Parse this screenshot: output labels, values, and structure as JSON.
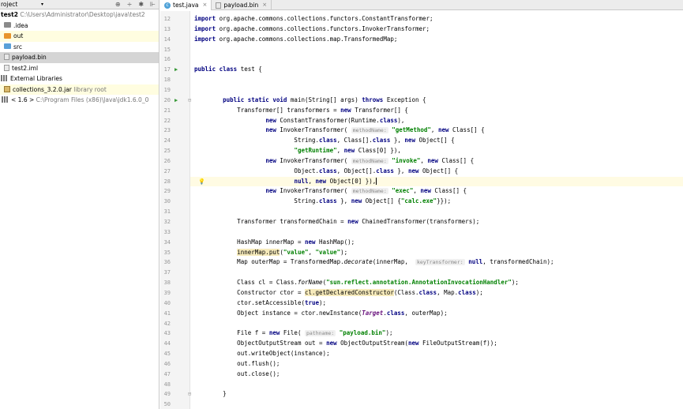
{
  "project_panel": {
    "header_label": "roject",
    "tools": [
      "⊕",
      "÷",
      "✱",
      "⊩"
    ],
    "tree": [
      {
        "name": "test2",
        "path": "C:\\Users\\Administrator\\Desktop\\java\\test2",
        "icon": "module-folder-icon",
        "indent": 0
      },
      {
        "name": ".idea",
        "path": "",
        "icon": "folder-icon",
        "indent": 1
      },
      {
        "name": "out",
        "path": "",
        "icon": "excluded-folder-icon",
        "indent": 1
      },
      {
        "name": "src",
        "path": "",
        "icon": "source-folder-icon",
        "indent": 1
      },
      {
        "name": "payload.bin",
        "path": "",
        "icon": "file-icon",
        "indent": 1
      },
      {
        "name": "test2.iml",
        "path": "",
        "icon": "file-icon",
        "indent": 1
      },
      {
        "name": "External Libraries",
        "path": "",
        "icon": "library-icon",
        "indent": 0
      },
      {
        "name": "collections_3.2.0.jar",
        "path": "library root",
        "icon": "jar-icon",
        "indent": 1
      },
      {
        "name": "< 1.6 >",
        "path": "C:\\Program Files (x86)\\Java\\jdk1.6.0_0",
        "icon": "jdk-icon",
        "indent": 1
      }
    ]
  },
  "tabs": [
    {
      "label": "test.java",
      "close": "×",
      "icon": "java-class-icon",
      "active": true
    },
    {
      "label": "payload.bin",
      "close": "×",
      "icon": "file-icon",
      "active": false
    }
  ],
  "editor": {
    "line_numbers": [
      "12",
      "13",
      "14",
      "15",
      "16",
      "17",
      "18",
      "19",
      "20",
      "21",
      "22",
      "23",
      "24",
      "25",
      "26",
      "27",
      "28",
      "29",
      "30",
      "31",
      "32",
      "33",
      "34",
      "35",
      "36",
      "37",
      "38",
      "39",
      "40",
      "41",
      "42",
      "43",
      "44",
      "45",
      "46",
      "47",
      "48",
      "49",
      "50"
    ]
  }
}
